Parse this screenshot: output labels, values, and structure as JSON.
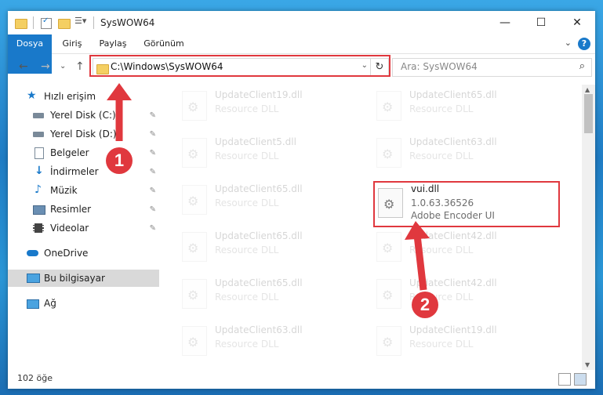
{
  "window": {
    "title": "SysWOW64",
    "minimize_glyph": "—",
    "maximize_glyph": "☐",
    "close_glyph": "✕"
  },
  "ribbon": {
    "tabs": [
      "Dosya",
      "Giriş",
      "Paylaş",
      "Görünüm"
    ],
    "help_glyph": "?",
    "expand_glyph": "⌄"
  },
  "navbar": {
    "back_glyph": "←",
    "forward_glyph": "→",
    "recent_glyph": "⌄",
    "up_glyph": "↑",
    "address": "C:\\Windows\\SysWOW64",
    "address_dropdown_glyph": "⌄",
    "refresh_glyph": "↻",
    "search_placeholder": "Ara: SysWOW64",
    "search_glyph": "⌕"
  },
  "sidebar": {
    "items": [
      {
        "label": "Hızlı erişim",
        "icon": "star-icon",
        "pinned": false
      },
      {
        "label": "Yerel Disk (C:)",
        "icon": "drive-icon",
        "pinned": true
      },
      {
        "label": "Yerel Disk (D:)",
        "icon": "drive-icon",
        "pinned": true
      },
      {
        "label": "Belgeler",
        "icon": "document-icon",
        "pinned": true
      },
      {
        "label": "İndirmeler",
        "icon": "download-icon",
        "pinned": true
      },
      {
        "label": "Müzik",
        "icon": "music-icon",
        "pinned": true
      },
      {
        "label": "Resimler",
        "icon": "pictures-icon",
        "pinned": true
      },
      {
        "label": "Videolar",
        "icon": "video-icon",
        "pinned": true
      },
      {
        "label": "OneDrive",
        "icon": "cloud-icon",
        "pinned": false
      },
      {
        "label": "Bu bilgisayar",
        "icon": "computer-icon",
        "pinned": false
      },
      {
        "label": "Ağ",
        "icon": "network-icon",
        "pinned": false
      }
    ],
    "pin_glyph": "📌"
  },
  "files": {
    "left_column": [
      {
        "name": "UpdateClient19.dll",
        "type": "Resource DLL"
      },
      {
        "name": "UpdateClient5.dll",
        "type": "Resource DLL"
      },
      {
        "name": "UpdateClient65.dll",
        "type": "Resource DLL"
      },
      {
        "name": "UpdateClient65.dll",
        "type": "Resource DLL"
      },
      {
        "name": "UpdateClient65.dll",
        "type": "Resource DLL"
      },
      {
        "name": "UpdateClient63.dll",
        "type": "Resource DLL"
      }
    ],
    "right_column": [
      {
        "name": "UpdateClient65.dll",
        "type": "Resource DLL"
      },
      {
        "name": "UpdateClient63.dll",
        "type": "Resource DLL"
      },
      {
        "name": "UpdateClient42.dll",
        "type": "Resource DLL"
      },
      {
        "name": "UpdateClient42.dll",
        "type": "Resource DLL"
      },
      {
        "name": "UpdateClient19.dll",
        "type": "Resource DLL"
      }
    ],
    "highlighted": {
      "name": "vui.dll",
      "version": "1.0.63.36526",
      "description": "Adobe Encoder UI"
    },
    "gear_glyph": "⚙"
  },
  "status": {
    "item_count": "102 öğe"
  },
  "annotations": {
    "step1": "1",
    "step2": "2",
    "color": "#e0383e"
  }
}
